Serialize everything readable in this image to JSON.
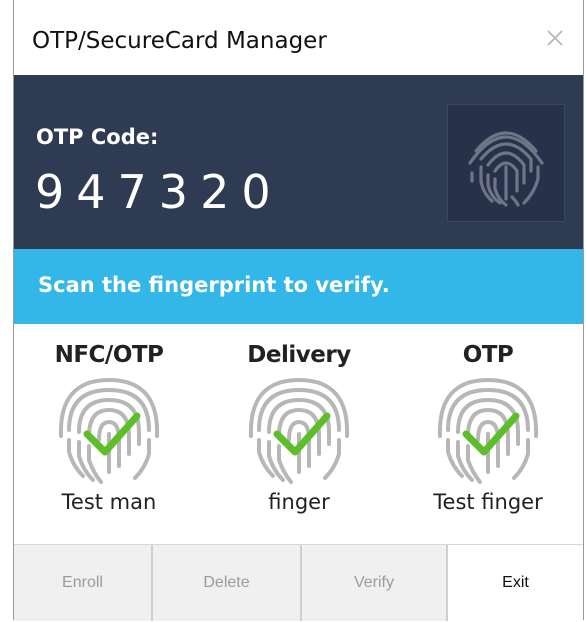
{
  "window": {
    "title": "OTP/SecureCard Manager"
  },
  "otp": {
    "label": "OTP Code:",
    "code": "947320"
  },
  "status": {
    "text": "Scan the fingerprint to verify."
  },
  "cards": [
    {
      "title": "NFC/OTP",
      "label": "Test man",
      "state": "verified"
    },
    {
      "title": "Delivery",
      "label": "finger",
      "state": "verified"
    },
    {
      "title": "OTP",
      "label": "Test finger",
      "state": "verified"
    }
  ],
  "buttons": {
    "enroll": "Enroll",
    "delete": "Delete",
    "verify": "Verify",
    "exit": "Exit"
  },
  "colors": {
    "panel": "#2f3b52",
    "accent": "#33b6e8",
    "check": "#5cbf2a",
    "fingerprint": "#b7b7b7"
  },
  "icons": {
    "close": "close-icon",
    "fingerprint": "fingerprint-icon",
    "check": "checkmark-icon"
  }
}
